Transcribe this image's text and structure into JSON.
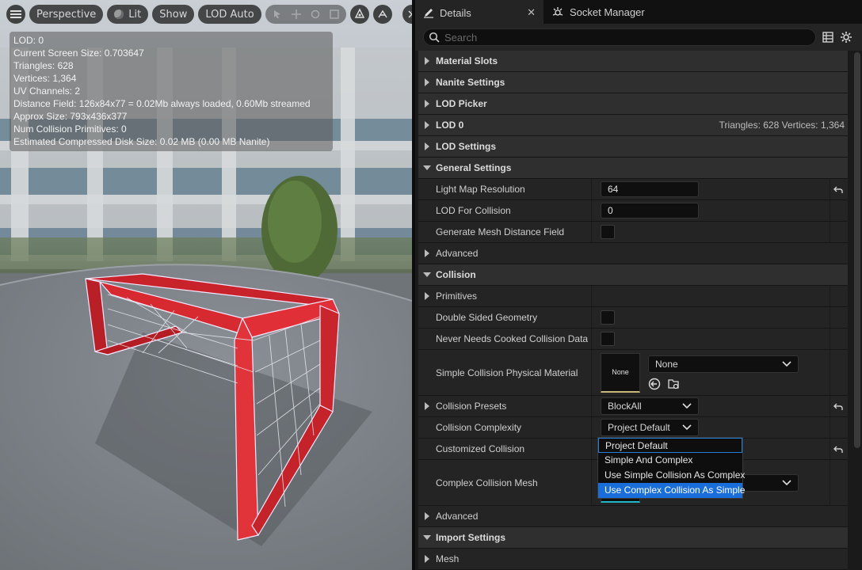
{
  "viewport": {
    "toolbar": {
      "perspective": "Perspective",
      "lit": "Lit",
      "show": "Show",
      "lod": "LOD Auto"
    },
    "stats": [
      "LOD:  0",
      "Current Screen Size:  0.703647",
      "Triangles:  628",
      "Vertices:  1,364",
      "UV Channels:  2",
      "Distance Field:  126x84x77 = 0.02Mb always loaded, 0.60Mb streamed",
      "Approx Size: 793x436x377",
      "Num Collision Primitives:  0",
      "Estimated Compressed Disk Size: 0.02 MB (0.00 MB Nanite)"
    ]
  },
  "details": {
    "tabs": {
      "details": "Details",
      "socket_manager": "Socket Manager"
    },
    "search_placeholder": "Search",
    "rows": {
      "material_slots": "Material Slots",
      "nanite_settings": "Nanite Settings",
      "lod_picker": "LOD Picker",
      "lod0": "LOD 0",
      "lod0_info": "Triangles: 628   Vertices: 1,364",
      "lod_settings": "LOD Settings",
      "general_settings": "General Settings",
      "light_map_resolution": "Light Map Resolution",
      "light_map_resolution_value": "64",
      "lod_for_collision": "LOD For Collision",
      "lod_for_collision_value": "0",
      "generate_mesh_distance_field": "Generate Mesh Distance Field",
      "advanced_1": "Advanced",
      "collision": "Collision",
      "primitives": "Primitives",
      "double_sided_geometry": "Double Sided Geometry",
      "never_needs_cooked": "Never Needs Cooked Collision Data",
      "simple_collision_phys_mat": "Simple Collision Physical Material",
      "phys_mat_thumb": "None",
      "phys_mat_value": "None",
      "collision_presets": "Collision Presets",
      "collision_presets_value": "BlockAll",
      "collision_complexity": "Collision Complexity",
      "collision_complexity_value": "Project Default",
      "customized_collision": "Customized Collision",
      "complex_collision_mesh": "Complex Collision Mesh",
      "advanced_2": "Advanced",
      "import_settings": "Import Settings",
      "mesh": "Mesh"
    },
    "complexity_options": [
      "Project Default",
      "Simple And Complex",
      "Use Simple Collision As Complex",
      "Use Complex Collision As Simple"
    ]
  }
}
